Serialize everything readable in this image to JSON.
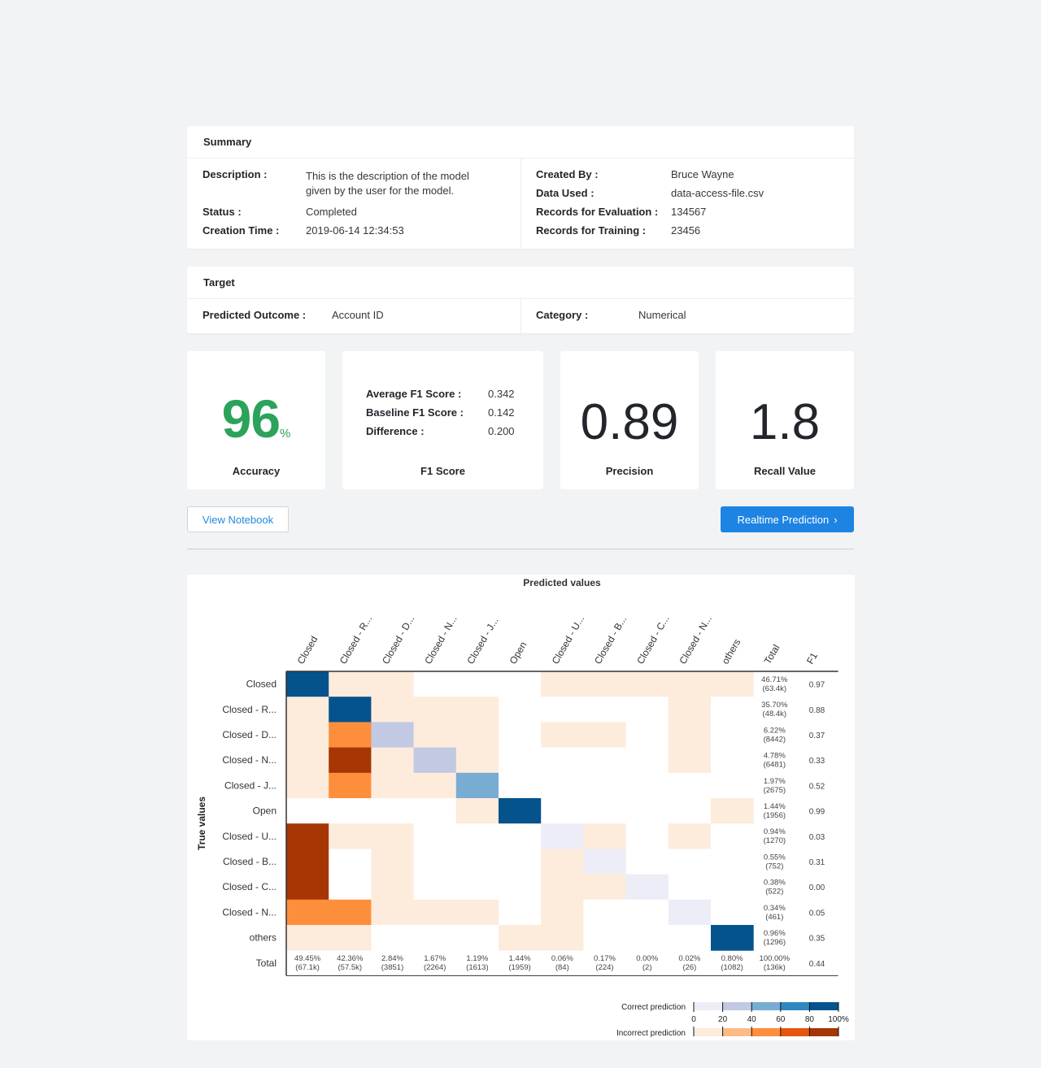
{
  "summary": {
    "title": "Summary",
    "description_label": "Description :",
    "description_value": "This is the description of the model given by the user for the model.",
    "status_label": "Status :",
    "status_value": "Completed",
    "creation_time_label": "Creation Time :",
    "creation_time_value": "2019-06-14 12:34:53",
    "created_by_label": "Created By :",
    "created_by_value": "Bruce Wayne",
    "data_used_label": "Data Used :",
    "data_used_value": "data-access-file.csv",
    "records_eval_label": "Records for Evaluation :",
    "records_eval_value": "134567",
    "records_train_label": "Records for Training :",
    "records_train_value": "23456"
  },
  "target": {
    "title": "Target",
    "predicted_outcome_label": "Predicted Outcome :",
    "predicted_outcome_value": "Account ID",
    "category_label": "Category :",
    "category_value": "Numerical"
  },
  "metrics": {
    "accuracy_value": "96",
    "accuracy_unit": "%",
    "accuracy_label": "Accuracy",
    "accuracy_color": "#2ba35b",
    "f1_avg_label": "Average F1 Score :",
    "f1_avg_value": "0.342",
    "f1_base_label": "Baseline F1 Score :",
    "f1_base_value": "0.142",
    "f1_diff_label": "Difference :",
    "f1_diff_value": "0.200",
    "f1_label": "F1 Score",
    "precision_value": "0.89",
    "precision_label": "Precision",
    "recall_value": "1.8",
    "recall_label": "Recall Value"
  },
  "actions": {
    "view_notebook": "View Notebook",
    "realtime_prediction": "Realtime Prediction",
    "realtime_icon": "chevron-right-icon"
  },
  "chart_data": {
    "type": "heatmap",
    "title": "Predicted values",
    "ylabel": "True values",
    "columns": [
      "Closed",
      "Closed - R...",
      "Closed - D...",
      "Closed - N...",
      "Closed - J...",
      "Open",
      "Closed - U...",
      "Closed - B...",
      "Closed - C...",
      "Closed - N...",
      "others",
      "Total",
      "F1"
    ],
    "rows": [
      "Closed",
      "Closed - R...",
      "Closed - D...",
      "Closed - N...",
      "Closed - J...",
      "Open",
      "Closed - U...",
      "Closed - B...",
      "Closed - C...",
      "Closed - N...",
      "others",
      "Total"
    ],
    "cell_levels_note_scale": "positive = correct prediction intensity 0-100, negative = incorrect prediction intensity 0-100",
    "cells": [
      [
        95,
        -5,
        -5,
        0,
        0,
        0,
        -5,
        -5,
        -5,
        -5,
        -5
      ],
      [
        -5,
        95,
        -5,
        -5,
        -5,
        0,
        0,
        0,
        0,
        -5,
        0
      ],
      [
        -5,
        -50,
        30,
        -5,
        -5,
        0,
        -5,
        -5,
        0,
        -5,
        0
      ],
      [
        -5,
        -80,
        -5,
        30,
        -5,
        0,
        0,
        0,
        0,
        -5,
        0
      ],
      [
        -5,
        -50,
        -5,
        -5,
        55,
        0,
        0,
        0,
        0,
        0,
        0
      ],
      [
        0,
        0,
        0,
        0,
        -5,
        98,
        0,
        0,
        0,
        0,
        -5
      ],
      [
        -98,
        -5,
        -5,
        0,
        0,
        0,
        8,
        -5,
        0,
        -5,
        0
      ],
      [
        -80,
        0,
        -5,
        0,
        0,
        0,
        -5,
        8,
        0,
        0,
        0
      ],
      [
        -98,
        0,
        -5,
        0,
        0,
        0,
        -5,
        -5,
        8,
        0,
        0
      ],
      [
        -50,
        -50,
        -5,
        -5,
        -5,
        0,
        -5,
        0,
        0,
        8,
        0
      ],
      [
        -5,
        -5,
        0,
        0,
        0,
        -5,
        -5,
        0,
        0,
        0,
        95
      ]
    ],
    "row_totals": [
      [
        "46.71%",
        "(63.4k)"
      ],
      [
        "35.70%",
        "(48.4k)"
      ],
      [
        "6.22%",
        "(8442)"
      ],
      [
        "4.78%",
        "(6481)"
      ],
      [
        "1.97%",
        "(2675)"
      ],
      [
        "1.44%",
        "(1956)"
      ],
      [
        "0.94%",
        "(1270)"
      ],
      [
        "0.55%",
        "(752)"
      ],
      [
        "0.38%",
        "(522)"
      ],
      [
        "0.34%",
        "(461)"
      ],
      [
        "0.96%",
        "(1296)"
      ]
    ],
    "f1": [
      "0.97",
      "0.88",
      "0.37",
      "0.33",
      "0.52",
      "0.99",
      "0.03",
      "0.31",
      "0.00",
      "0.05",
      "0.35",
      "0.44"
    ],
    "col_totals": [
      [
        "49.45%",
        "(67.1k)"
      ],
      [
        "42.36%",
        "(57.5k)"
      ],
      [
        "2.84%",
        "(3851)"
      ],
      [
        "1.67%",
        "(2264)"
      ],
      [
        "1.19%",
        "(1613)"
      ],
      [
        "1.44%",
        "(1959)"
      ],
      [
        "0.06%",
        "(84)"
      ],
      [
        "0.17%",
        "(224)"
      ],
      [
        "0.00%",
        "(2)"
      ],
      [
        "0.02%",
        "(26)"
      ],
      [
        "0.80%",
        "(1082)"
      ],
      [
        "100.00%",
        "(136k)"
      ]
    ],
    "legend": {
      "correct_label": "Correct prediction",
      "incorrect_label": "Incorrect prediction",
      "ticks": [
        "0",
        "20",
        "40",
        "60",
        "80",
        "100%"
      ],
      "correct_colors": [
        "#ededf7",
        "#c1c9e3",
        "#78acd3",
        "#2f87c0",
        "#05538d"
      ],
      "incorrect_colors": [
        "#fdebdc",
        "#fcbb86",
        "#fd8e3c",
        "#e6550d",
        "#a63603"
      ]
    }
  }
}
